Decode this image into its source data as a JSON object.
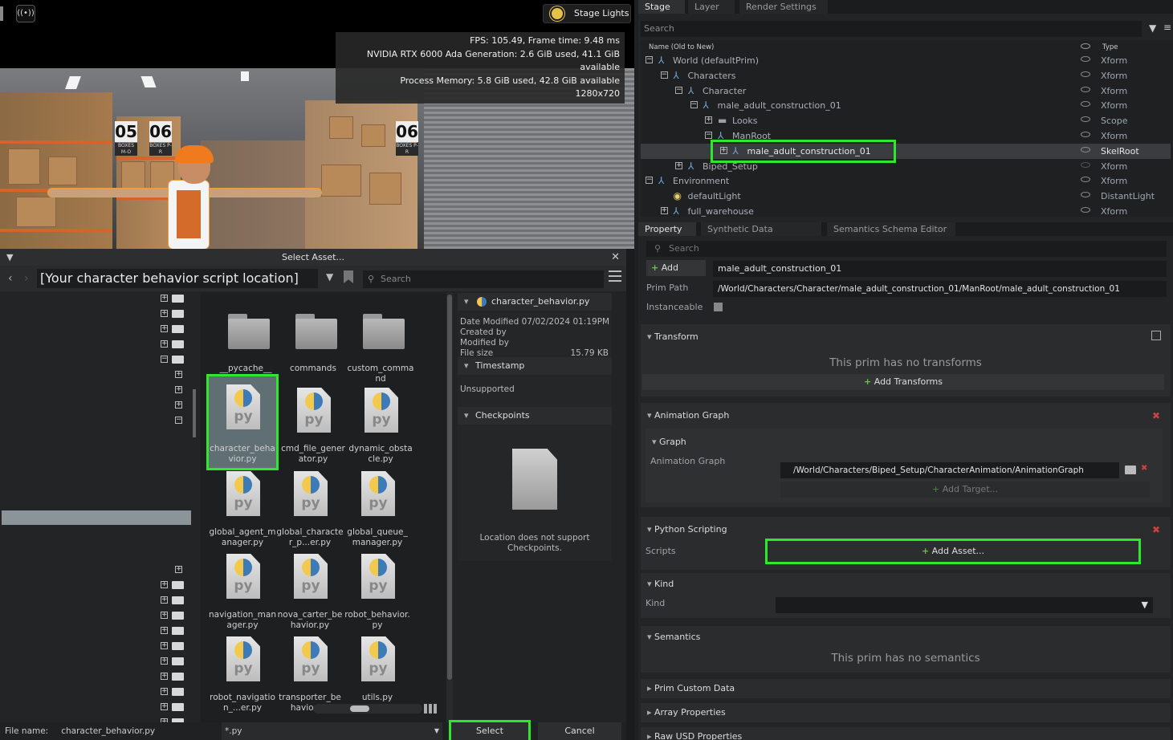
{
  "viewport": {
    "stage_lights_label": "Stage Lights",
    "stats": [
      "FPS: 105.49, Frame time: 9.48 ms",
      "NVIDIA RTX 6000 Ada Generation: 2.6 GiB used, 41.1 GiB available",
      "Process Memory: 5.8 GiB used, 42.8 GiB available",
      "1280x720"
    ],
    "live_icon": "((•))",
    "signs": [
      {
        "num": "05",
        "sub": "BOXES M-O"
      },
      {
        "num": "06",
        "sub": "BOXES P-R"
      },
      {
        "num": "06",
        "sub": "BOXES P-R"
      }
    ]
  },
  "dialog": {
    "title": "Select Asset...",
    "path_value": "[Your character behavior script location]",
    "search_placeholder": "Search",
    "tiles": [
      {
        "label": "__pycache__",
        "kind": "folder"
      },
      {
        "label": "commands",
        "kind": "folder"
      },
      {
        "label": "custom_command",
        "kind": "folder"
      },
      {
        "label": "character_behavior.py",
        "kind": "py"
      },
      {
        "label": "cmd_file_generator.py",
        "kind": "py"
      },
      {
        "label": "dynamic_obstacle.py",
        "kind": "py"
      },
      {
        "label": "global_agent_manager.py",
        "kind": "py"
      },
      {
        "label": "global_character_p...er.py",
        "kind": "py"
      },
      {
        "label": "global_queue_manager.py",
        "kind": "py"
      },
      {
        "label": "navigation_manager.py",
        "kind": "py"
      },
      {
        "label": "nova_carter_behavior.py",
        "kind": "py"
      },
      {
        "label": "robot_behavior.py",
        "kind": "py"
      },
      {
        "label": "robot_navigation_...er.py",
        "kind": "py"
      },
      {
        "label": "transporter_behavior.py",
        "kind": "py"
      },
      {
        "label": "utils.py",
        "kind": "py"
      }
    ],
    "info": {
      "file": "character_behavior.py",
      "date_modified_label": "Date Modified",
      "date_modified": "07/02/2024 01:19PM",
      "created_by": "Created by",
      "modified_by": "Modified by",
      "file_size_label": "File size",
      "file_size": "15.79 KB",
      "timestamp_header": "Timestamp",
      "timestamp_value": "Unsupported",
      "checkpoints_header": "Checkpoints",
      "checkpoints_msg": "Location does not support Checkpoints."
    },
    "file_name_label": "File name:",
    "file_name_value": "character_behavior.py",
    "file_type": "*.py",
    "select_label": "Select",
    "cancel_label": "Cancel"
  },
  "stage": {
    "tabs": [
      "Stage",
      "Layer",
      "Render Settings"
    ],
    "search_placeholder": "Search",
    "col_name": "Name (Old to New)",
    "col_type": "Type",
    "rows": [
      {
        "name": "World (defaultPrim)",
        "type": "Xform",
        "depth": 0,
        "exp": "−"
      },
      {
        "name": "Characters",
        "type": "Xform",
        "depth": 1,
        "exp": "−"
      },
      {
        "name": "Character",
        "type": "Xform",
        "depth": 2,
        "exp": "−"
      },
      {
        "name": "male_adult_construction_01",
        "type": "Xform",
        "depth": 3,
        "exp": "−"
      },
      {
        "name": "Looks",
        "type": "Scope",
        "depth": 4,
        "exp": "+"
      },
      {
        "name": "ManRoot",
        "type": "Xform",
        "depth": 4,
        "exp": "−"
      },
      {
        "name": "male_adult_construction_01",
        "type": "SkelRoot",
        "depth": 5,
        "exp": "+"
      },
      {
        "name": "Biped_Setup",
        "type": "Xform",
        "depth": 2,
        "exp": "+"
      },
      {
        "name": "Environment",
        "type": "Xform",
        "depth": 0,
        "exp": "−"
      },
      {
        "name": "defaultLight",
        "type": "DistantLight",
        "depth": 1,
        "exp": ""
      },
      {
        "name": "full_warehouse",
        "type": "Xform",
        "depth": 1,
        "exp": "+"
      }
    ]
  },
  "property": {
    "tabs": [
      "Property",
      "Synthetic Data Recorder",
      "Semantics Schema Editor"
    ],
    "search_placeholder": "Search",
    "add_label": "Add",
    "prim_name": "male_adult_construction_01",
    "prim_path_label": "Prim Path",
    "prim_path": "/World/Characters/Character/male_adult_construction_01/ManRoot/male_adult_construction_01",
    "instanceable_label": "Instanceable",
    "transform_header": "Transform",
    "no_transforms": "This prim has no transforms",
    "add_transforms": "Add Transforms",
    "anim_header": "Animation Graph",
    "graph_header": "Graph",
    "anim_graph_label": "Animation Graph",
    "anim_graph_path": "/World/Characters/Biped_Setup/CharacterAnimation/AnimationGraph",
    "add_target": "Add Target...",
    "python_header": "Python Scripting",
    "scripts_label": "Scripts",
    "add_asset": "Add Asset...",
    "kind_header": "Kind",
    "kind_label": "Kind",
    "semantics_header": "Semantics",
    "no_semantics": "This prim has no semantics",
    "prim_custom": "Prim Custom Data",
    "array_props": "Array Properties",
    "raw_usd": "Raw USD Properties"
  }
}
